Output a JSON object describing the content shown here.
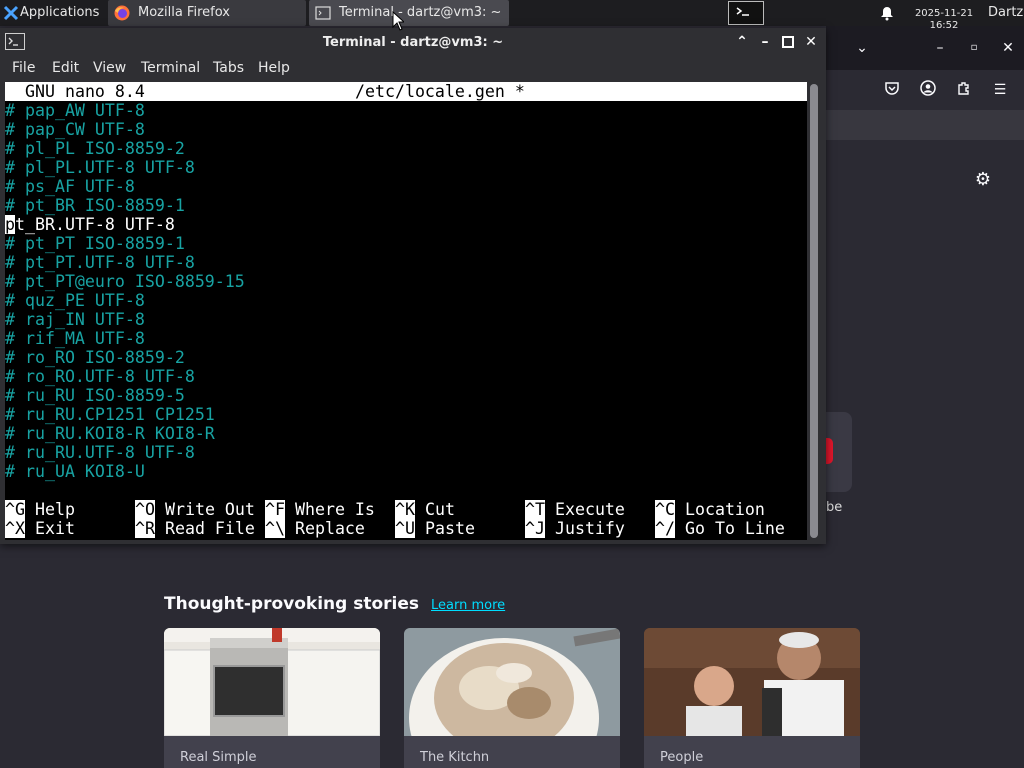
{
  "panel": {
    "applications_label": "Applications",
    "tasks": [
      {
        "label": "Mozilla Firefox"
      },
      {
        "label": "Terminal - dartz@vm3: ~"
      }
    ],
    "clock_date": "2025-11-21",
    "clock_time": "16:52",
    "user": "Dartz"
  },
  "terminal": {
    "title": "Terminal - dartz@vm3: ~",
    "menu": [
      "File",
      "Edit",
      "View",
      "Terminal",
      "Tabs",
      "Help"
    ],
    "nano": {
      "version": "GNU nano 8.4",
      "filename": "/etc/locale.gen *",
      "lines": [
        {
          "text": "# pap_AW UTF-8",
          "commented": true
        },
        {
          "text": "# pap_CW UTF-8",
          "commented": true
        },
        {
          "text": "# pl_PL ISO-8859-2",
          "commented": true
        },
        {
          "text": "# pl_PL.UTF-8 UTF-8",
          "commented": true
        },
        {
          "text": "# ps_AF UTF-8",
          "commented": true
        },
        {
          "text": "# pt_BR ISO-8859-1",
          "commented": true
        },
        {
          "text": "pt_BR.UTF-8 UTF-8",
          "commented": false,
          "cursor": true
        },
        {
          "text": "# pt_PT ISO-8859-1",
          "commented": true
        },
        {
          "text": "# pt_PT.UTF-8 UTF-8",
          "commented": true
        },
        {
          "text": "# pt_PT@euro ISO-8859-15",
          "commented": true
        },
        {
          "text": "# quz_PE UTF-8",
          "commented": true
        },
        {
          "text": "# raj_IN UTF-8",
          "commented": true
        },
        {
          "text": "# rif_MA UTF-8",
          "commented": true
        },
        {
          "text": "# ro_RO ISO-8859-2",
          "commented": true
        },
        {
          "text": "# ro_RO.UTF-8 UTF-8",
          "commented": true
        },
        {
          "text": "# ru_RU ISO-8859-5",
          "commented": true
        },
        {
          "text": "# ru_RU.CP1251 CP1251",
          "commented": true
        },
        {
          "text": "# ru_RU.KOI8-R KOI8-R",
          "commented": true
        },
        {
          "text": "# ru_RU.UTF-8 UTF-8",
          "commented": true
        },
        {
          "text": "# ru_UA KOI8-U",
          "commented": true
        }
      ],
      "shortcuts": [
        [
          {
            "key": "^G",
            "label": "Help"
          },
          {
            "key": "^X",
            "label": "Exit"
          }
        ],
        [
          {
            "key": "^O",
            "label": "Write Out"
          },
          {
            "key": "^R",
            "label": "Read File"
          }
        ],
        [
          {
            "key": "^F",
            "label": "Where Is"
          },
          {
            "key": "^\\",
            "label": "Replace"
          }
        ],
        [
          {
            "key": "^K",
            "label": "Cut"
          },
          {
            "key": "^U",
            "label": "Paste"
          }
        ],
        [
          {
            "key": "^T",
            "label": "Execute"
          },
          {
            "key": "^J",
            "label": "Justify"
          }
        ],
        [
          {
            "key": "^C",
            "label": "Location"
          },
          {
            "key": "^/",
            "label": "Go To Line"
          }
        ]
      ]
    }
  },
  "firefox": {
    "stories_title": "Thought-provoking stories",
    "learn_more": "Learn more",
    "partial_tile_label": "be",
    "cards": [
      {
        "source": "Real Simple"
      },
      {
        "source": "The Kitchn"
      },
      {
        "source": "People"
      }
    ]
  }
}
